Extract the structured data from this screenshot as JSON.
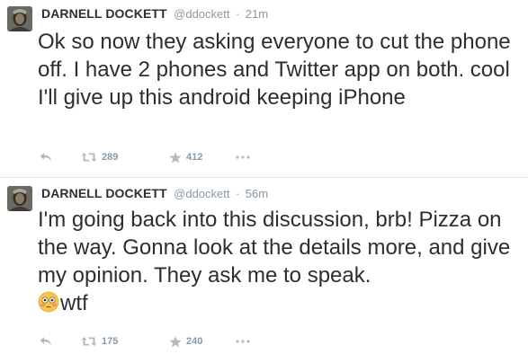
{
  "tweets": [
    {
      "author": "DARNELL DOCKETT",
      "handle": "@ddockett",
      "separator": "·",
      "time": "21m",
      "text": "Ok so now they asking everyone to cut the phone off. I have 2 phones and Twitter app on both. cool I'll give up this android keeping iPhone",
      "retweets": "289",
      "favorites": "412"
    },
    {
      "author": "DARNELL DOCKETT",
      "handle": "@ddockett",
      "separator": "·",
      "time": "56m",
      "text": "I'm going back into this discussion, brb! Pizza on the way. Gonna look at the details more, and give my opinion. They ask me to speak.",
      "emoji": "flushed-face",
      "text_after_emoji": "wtf",
      "retweets": "175",
      "favorites": "240"
    }
  ],
  "icons": {
    "reply": "reply-icon",
    "retweet": "retweet-icon",
    "favorite": "star-icon",
    "more": "more-dots-icon"
  },
  "colors": {
    "text": "#292f33",
    "meta": "#8899a6",
    "icon": "#b1bbc3",
    "divider": "#e1e8ed"
  }
}
